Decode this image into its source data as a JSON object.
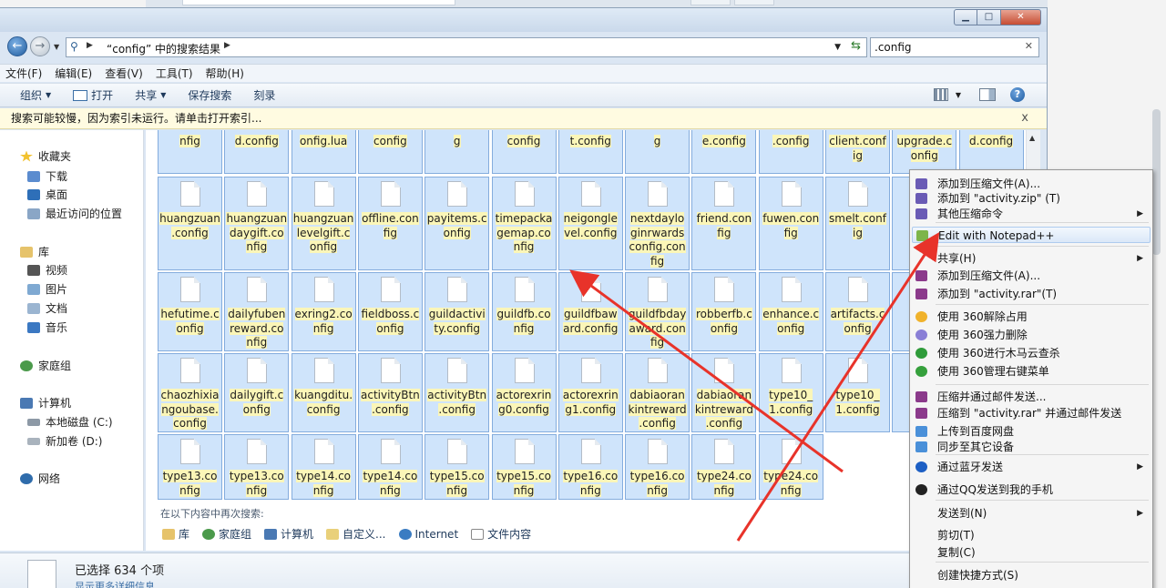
{
  "address": {
    "crumb": "“config” 中的搜索结果",
    "search_value": ".config"
  },
  "menubar": [
    "文件(F)",
    "编辑(E)",
    "查看(V)",
    "工具(T)",
    "帮助(H)"
  ],
  "toolbar": {
    "organize": "组织",
    "open": "打开",
    "share": "共享",
    "save_search": "保存搜索",
    "burn": "刻录"
  },
  "infobar": "搜索可能较慢，因为索引未运行。请单击打开索引...",
  "nav": {
    "favorites": "收藏夹",
    "downloads": "下载",
    "desktop": "桌面",
    "recent": "最近访问的位置",
    "libraries": "库",
    "videos": "视频",
    "pictures": "图片",
    "documents": "文档",
    "music": "音乐",
    "homegroup": "家庭组",
    "computer": "计算机",
    "drive_c": "本地磁盘 (C:)",
    "drive_d": "新加卷 (D:)",
    "network": "网络"
  },
  "files": {
    "row0": [
      [
        "nfig"
      ],
      [
        "d.config"
      ],
      [
        "onfig.lua"
      ],
      [
        "config"
      ],
      [
        "g"
      ],
      [
        "config"
      ],
      [
        "t.config"
      ],
      [
        "g"
      ],
      [
        "e.config"
      ],
      [
        ".config"
      ],
      [
        "client.conf",
        "ig"
      ],
      [
        "upgrade.c",
        "onfig"
      ],
      [
        "d.config"
      ]
    ],
    "row1": [
      [
        "huangzuan",
        ".config"
      ],
      [
        "huangzuan",
        "daygift.co",
        "nfig"
      ],
      [
        "huangzuan",
        "levelgift.c",
        "onfig"
      ],
      [
        "offline.con",
        "fig"
      ],
      [
        "payitems.c",
        "onfig"
      ],
      [
        "timepacka",
        "gemap.co",
        "nfig"
      ],
      [
        "neigongle",
        "vel.config"
      ],
      [
        "nextdaylo",
        "ginrwards",
        "config.con",
        "fig"
      ],
      [
        "friend.con",
        "fig"
      ],
      [
        "fuwen.con",
        "fig"
      ],
      [
        "smelt.conf",
        "ig"
      ],
      [
        "sm"
      ]
    ],
    "row2": [
      [
        "hefutime.c",
        "onfig"
      ],
      [
        "dailyfuben",
        "reward.co",
        "nfig"
      ],
      [
        "exring2.co",
        "nfig"
      ],
      [
        "fieldboss.c",
        "onfig"
      ],
      [
        "guildactivi",
        "ty.config"
      ],
      [
        "guildfb.co",
        "nfig"
      ],
      [
        "guildfbaw",
        "ard.config"
      ],
      [
        "guildfbday",
        "award.con",
        "fig"
      ],
      [
        "robberfb.c",
        "onfig"
      ],
      [
        "enhance.c",
        "onfig"
      ],
      [
        "artifacts.c",
        "onfig"
      ],
      [
        "ba",
        "g"
      ]
    ],
    "row3": [
      [
        "chaozhixia",
        "ngoubase.",
        "config"
      ],
      [
        "dailygift.c",
        "onfig"
      ],
      [
        "kuangditu.",
        "config"
      ],
      [
        "activityBtn",
        ".config"
      ],
      [
        "activityBtn",
        ".config"
      ],
      [
        "actorexrin",
        "g0.config"
      ],
      [
        "actorexrin",
        "g1.config"
      ],
      [
        "dabiaoran",
        "kintreward",
        ".config"
      ],
      [
        "dabiaoran",
        "kintreward",
        ".config"
      ],
      [
        "type10_",
        "1.config"
      ],
      [
        "type10_",
        "1.config"
      ],
      [
        "ty",
        "3"
      ]
    ],
    "row4": [
      [
        "type13.co",
        "nfig"
      ],
      [
        "type13.co",
        "nfig"
      ],
      [
        "type14.co",
        "nfig"
      ],
      [
        "type14.co",
        "nfig"
      ],
      [
        "type15.co",
        "nfig"
      ],
      [
        "type15.co",
        "nfig"
      ],
      [
        "type16.co",
        "nfig"
      ],
      [
        "type16.co",
        "nfig"
      ],
      [
        "type24.co",
        "nfig"
      ],
      [
        "type24.co",
        "nfig"
      ]
    ]
  },
  "search_again": {
    "label": "在以下内容中再次搜索:",
    "links": [
      "库",
      "家庭组",
      "计算机",
      "自定义...",
      "Internet",
      "文件内容"
    ]
  },
  "details": {
    "selected": "已选择 634 个项",
    "more": "显示更多详细信息..."
  },
  "context_menu": [
    {
      "label": "添加到压缩文件(A)...",
      "icon": "rar-icon"
    },
    {
      "label": "添加到 \"activity.zip\" (T)",
      "icon": "rar-icon"
    },
    {
      "label": "其他压缩命令",
      "icon": "rar-icon",
      "sub": true
    },
    {
      "label": "Edit with Notepad++",
      "icon": "notepad-icon",
      "hover": true
    },
    {
      "label": "共享(H)",
      "icon": "",
      "sub": true
    },
    {
      "label": "添加到压缩文件(A)...",
      "icon": "winrar-icon"
    },
    {
      "label": "添加到 \"activity.rar\"(T)",
      "icon": "winrar-icon"
    },
    {
      "label": "使用 360解除占用",
      "icon": "360-unlock-icon"
    },
    {
      "label": "使用 360强力删除",
      "icon": "360-delete-icon"
    },
    {
      "label": "使用 360进行木马云查杀",
      "icon": "360-scan-icon"
    },
    {
      "label": "使用 360管理右键菜单",
      "icon": "360-menu-icon"
    },
    {
      "label": "压缩并通过邮件发送...",
      "icon": "winrar-icon"
    },
    {
      "label": "压缩到 \"activity.rar\" 并通过邮件发送",
      "icon": "winrar-icon"
    },
    {
      "label": "上传到百度网盘",
      "icon": "baidu-icon"
    },
    {
      "label": "同步至其它设备",
      "icon": "baidu-icon"
    },
    {
      "label": "通过蓝牙发送",
      "icon": "bluetooth-icon",
      "sub": true
    },
    {
      "label": "通过QQ发送到我的手机",
      "icon": "qq-icon"
    },
    {
      "label": "发送到(N)",
      "icon": "",
      "sub": true
    },
    {
      "label": "剪切(T)",
      "icon": ""
    },
    {
      "label": "复制(C)",
      "icon": ""
    },
    {
      "label": "创建快捷方式(S)",
      "icon": ""
    }
  ],
  "colors": {
    "tile_bg": "#cfe4fb",
    "tile_border": "#84acdd",
    "highlight": "#fbf6b8",
    "arrow": "#e8332a"
  }
}
